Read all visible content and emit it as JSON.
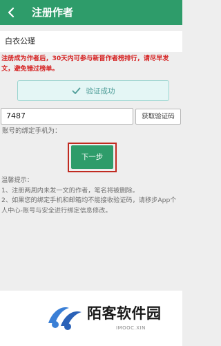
{
  "app_bar": {
    "title": "注册作者",
    "back_icon": "chevron-left-icon",
    "color": "#2e9c6a"
  },
  "form": {
    "pen_name": "白衣公瑾",
    "notice": "注册成为作者后，30天内可参与新晋作者榜排行，请尽早发文，避免错过榜单。",
    "verify_status": "验证成功",
    "verify_icon": "check-icon",
    "code_value": "7487",
    "get_code_label": "获取验证码",
    "bind_phone_label": "账号的绑定手机为：",
    "next_label": "下一步"
  },
  "tips": {
    "heading": "温馨提示：",
    "line1": "1、注册两周内未发一文的作者，笔名将被删除。",
    "line2": "2、如果您的绑定手机和邮箱均不能接收验证码，请移步App个人中心-账号与安全进行绑定信息修改。"
  },
  "watermark": {
    "name": "陌客软件园",
    "domain": "IMOOC.XIN"
  },
  "colors": {
    "accent": "#2e9c6a",
    "warning": "#d62424",
    "highlight_frame": "#c02a20"
  }
}
